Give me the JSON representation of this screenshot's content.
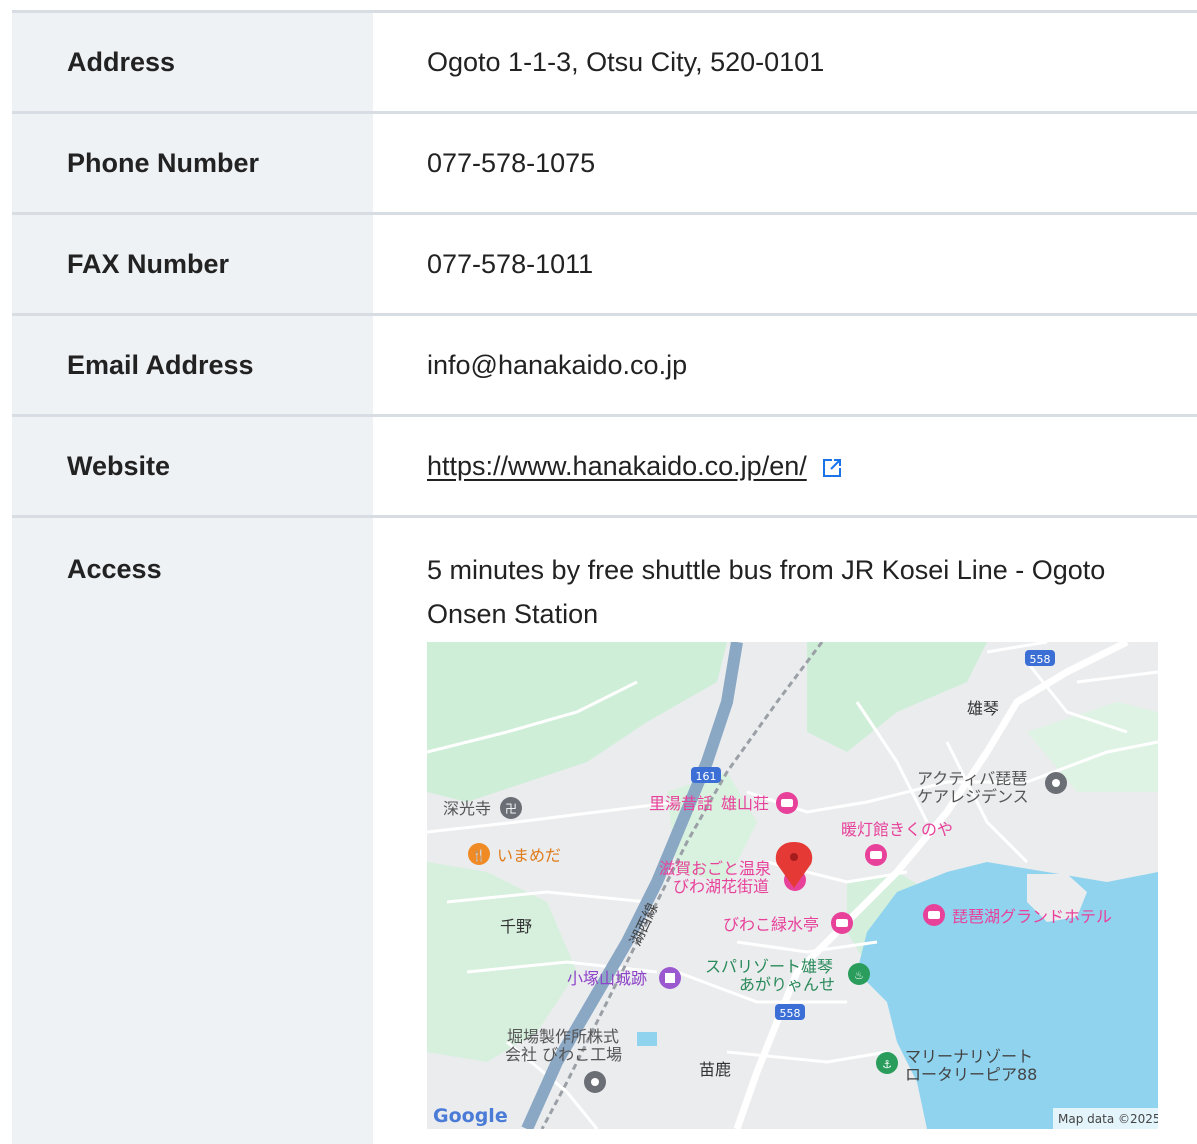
{
  "rows": {
    "address": {
      "label": "Address",
      "value": "Ogoto 1-1-3, Otsu City, 520-0101"
    },
    "phone": {
      "label": "Phone Number",
      "value": "077-578-1075"
    },
    "fax": {
      "label": "FAX Number",
      "value": "077-578-1011"
    },
    "email": {
      "label": "Email Address",
      "value": "info@hanakaido.co.jp"
    },
    "website": {
      "label": "Website",
      "value": "https://www.hanakaido.co.jp/en/",
      "icon": "external-link-icon"
    },
    "access": {
      "label": "Access",
      "value": "5 minutes by free shuttle bus from JR Kosei Line - Ogoto Onsen Station"
    }
  },
  "map": {
    "labels": {
      "shinkoji": "深光寺",
      "imameda": "いまめだ",
      "satoyu_1": "里湯昔話",
      "satoyu_2": "雄山荘",
      "ogoto_area": "雄琴",
      "activa_1": "アクティバ琵琶",
      "activa_2": "ケアレジデンス",
      "dantokan": "暖灯館きくのや",
      "hotel_1": "滋賀おごと温泉",
      "hotel_2": "びわ湖花街道",
      "senya": "千野",
      "midorimizu": "びわこ緑水亭",
      "grand_hotel": "琵琶湖グランドホテル",
      "kozukayama": "小塚山城跡",
      "spa_1": "スパリゾート雄琴",
      "spa_2": "あがりゃんせ",
      "horiba_1": "堀場製作所株式",
      "horiba_2": "会社 びわこ工場",
      "naeka": "苗鹿",
      "marina_1": "マリーナリゾート",
      "marina_2": "ロータリーピア88",
      "kosei_line": "湖西線",
      "route_161": "161",
      "route_558_top": "558",
      "route_558_mid": "558",
      "google": "Google",
      "map_data": "Map data ©2025"
    },
    "colors": {
      "land": "#eaecee",
      "green": "#cfeed8",
      "water": "#8fd3ef",
      "road": "#ffffff",
      "highway": "#8aa7c4",
      "lodging": "#e8419a",
      "food": "#f08a24",
      "attraction": "#9b59d0",
      "pin": "#e53935"
    }
  }
}
